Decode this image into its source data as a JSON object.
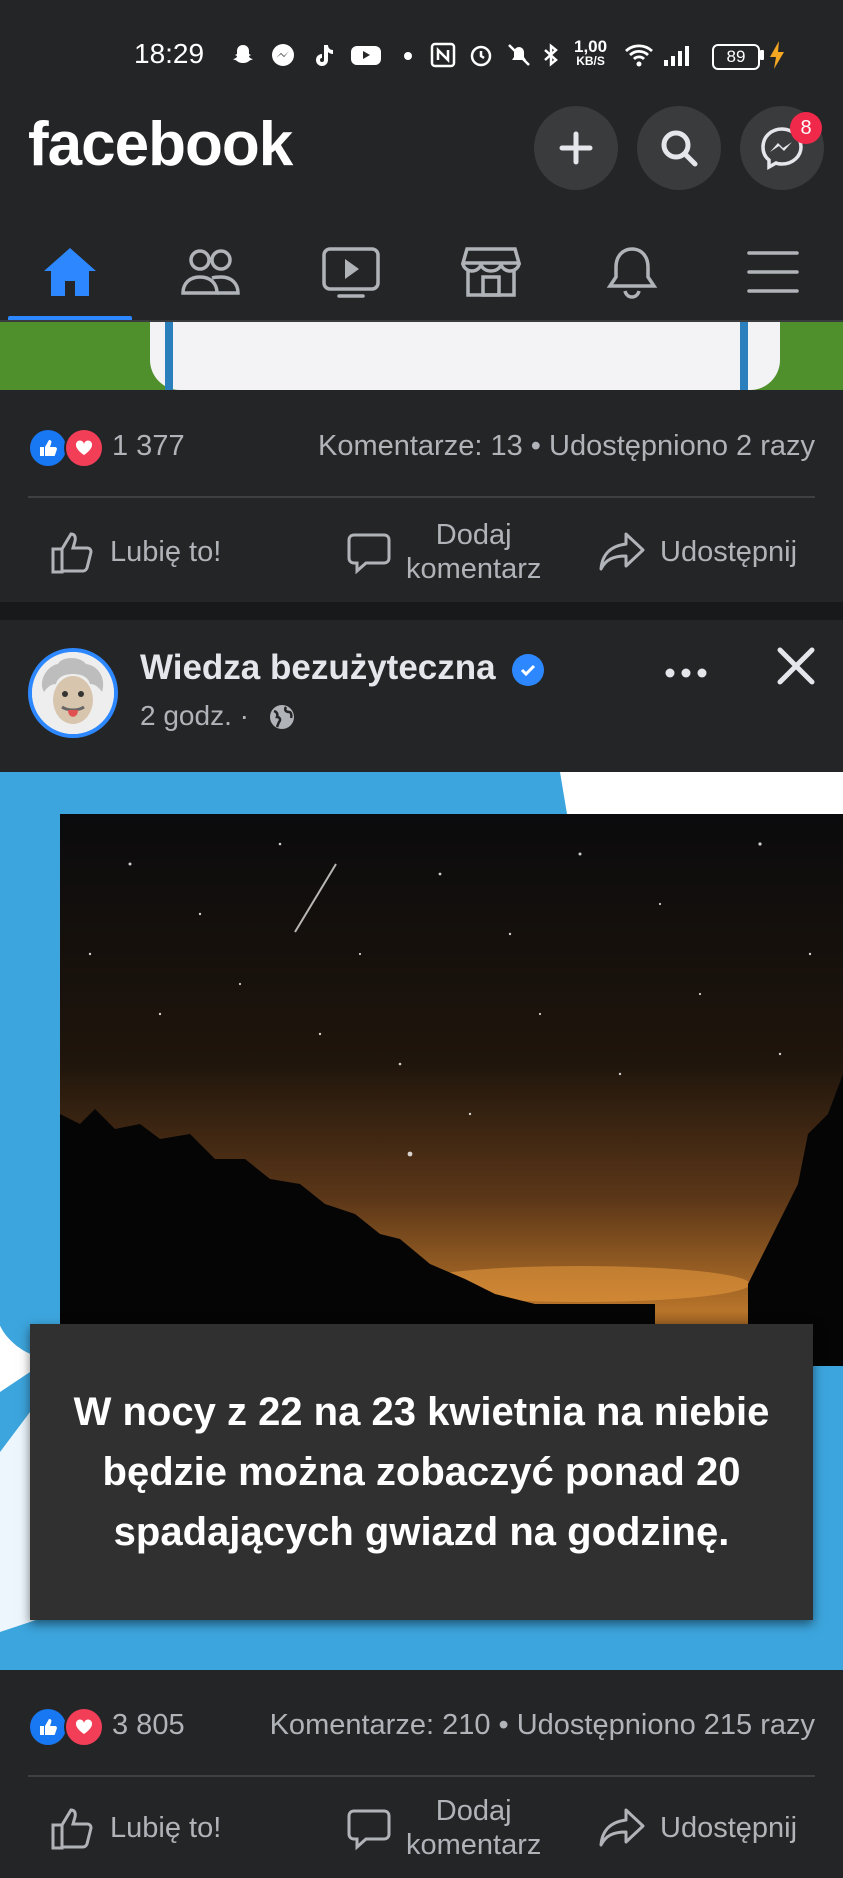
{
  "status_bar": {
    "time": "18:29",
    "net_speed_value": "1,00",
    "net_speed_unit": "KB/S",
    "battery": "89",
    "icons": [
      "snapchat-icon",
      "messenger-icon",
      "tiktok-icon",
      "youtube-icon",
      "dot-icon",
      "nfc-icon",
      "alarm-icon",
      "mute-icon",
      "bluetooth-icon",
      "wifi-icon",
      "signal-icon",
      "battery-icon",
      "charging-icon"
    ]
  },
  "header": {
    "logo": "facebook",
    "messenger_badge": "8"
  },
  "nav": {
    "tabs": [
      "home-icon",
      "friends-icon",
      "watch-icon",
      "marketplace-icon",
      "notifications-icon",
      "menu-icon"
    ],
    "active_tab": "home-icon",
    "active_color": "#2d88ff"
  },
  "post1": {
    "reactions_count": "1 377",
    "comments": "Komentarze: 13",
    "shares": "Udostępniono 2 razy",
    "actions": {
      "like": "Lubię to!",
      "comment_line1": "Dodaj",
      "comment_line2": "komentarz",
      "share": "Udostępnij"
    }
  },
  "post2": {
    "author": "Wiedza bezużyteczna",
    "time": "2 godz.",
    "separator": "·",
    "image_caption": "W nocy z 22 na 23 kwietnia na niebie będzie można zobaczyć ponad 20 spadających gwiazd na godzinę.",
    "reactions_count": "3 805",
    "comments": "Komentarze: 210",
    "shares": "Udostępniono 215 razy",
    "actions": {
      "like": "Lubię to!",
      "comment_line1": "Dodaj",
      "comment_line2": "komentarz",
      "share": "Udostępnij"
    }
  },
  "colors": {
    "background": "#242526",
    "accent": "#2d88ff",
    "like": "#1877f2",
    "love": "#f33e58",
    "badge": "#f02849",
    "post_image_bg": "#3ca5dd"
  }
}
